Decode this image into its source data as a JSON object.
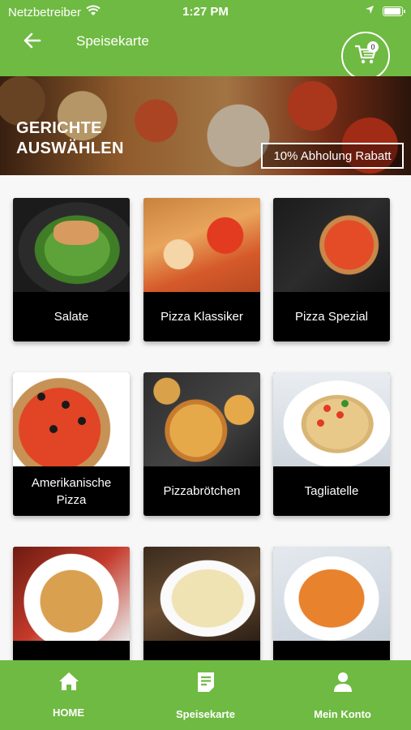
{
  "status_bar": {
    "carrier": "Netzbetreiber",
    "time": "1:27 PM"
  },
  "app_bar": {
    "title": "Speisekarte",
    "cart_count": "0"
  },
  "banner": {
    "title_line1": "GERICHTE",
    "title_line2": "AUSWÄHLEN",
    "badge": "10% Abholung Rabatt"
  },
  "categories": [
    {
      "label": "Salate"
    },
    {
      "label": "Pizza Klassiker"
    },
    {
      "label": "Pizza Spezial"
    },
    {
      "label": "Amerikanische Pizza"
    },
    {
      "label": "Pizzabrötchen"
    },
    {
      "label": "Tagliatelle"
    },
    {
      "label": ""
    },
    {
      "label": ""
    },
    {
      "label": ""
    }
  ],
  "bottom_nav": [
    {
      "label": "HOME",
      "icon": "home-icon"
    },
    {
      "label": "Speisekarte",
      "icon": "menu-list-icon"
    },
    {
      "label": "Mein Konto",
      "icon": "user-icon"
    }
  ],
  "colors": {
    "brand_green": "#6fba42",
    "card_label_bg": "#000000"
  }
}
